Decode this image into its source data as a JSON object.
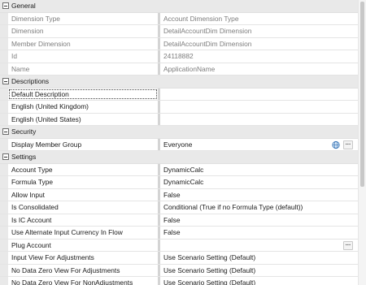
{
  "categories": {
    "general": "General",
    "descriptions": "Descriptions",
    "security": "Security",
    "settings": "Settings"
  },
  "general": [
    {
      "name": "Dimension Type",
      "value": "Account Dimension Type"
    },
    {
      "name": "Dimension",
      "value": "DetailAccountDim Dimension"
    },
    {
      "name": "Member Dimension",
      "value": "DetailAccountDim Dimension"
    },
    {
      "name": "Id",
      "value": "24118882"
    },
    {
      "name": "Name",
      "value": "ApplicationName"
    }
  ],
  "descriptions": [
    {
      "name": "Default Description",
      "value": ""
    },
    {
      "name": "English (United Kingdom)",
      "value": ""
    },
    {
      "name": "English (United States)",
      "value": ""
    }
  ],
  "security": [
    {
      "name": "Display Member Group",
      "value": "Everyone"
    }
  ],
  "settings": [
    {
      "name": "Account Type",
      "value": "DynamicCalc"
    },
    {
      "name": "Formula Type",
      "value": "DynamicCalc"
    },
    {
      "name": "Allow Input",
      "value": "False"
    },
    {
      "name": "Is Consolidated",
      "value": "Conditional (True if no Formula Type (default))"
    },
    {
      "name": "Is IC Account",
      "value": "False"
    },
    {
      "name": "Use Alternate Input Currency In Flow",
      "value": "False"
    },
    {
      "name": "Plug Account",
      "value": ""
    },
    {
      "name": "Input View For Adjustments",
      "value": "Use Scenario Setting (Default)"
    },
    {
      "name": "No Data Zero View For Adjustments",
      "value": "Use Scenario Setting (Default)"
    },
    {
      "name": "No Data Zero View For NonAdjustments",
      "value": "Use Scenario Setting (Default)"
    }
  ],
  "icons": {
    "collapse": "minus-box-icon",
    "ellipsis": "ellipsis-icon",
    "globe": "globe-icon"
  },
  "colors": {
    "category_background": "#e9e9e9",
    "readonly_text": "#7d7d7d",
    "divider": "#d4d4d4"
  }
}
